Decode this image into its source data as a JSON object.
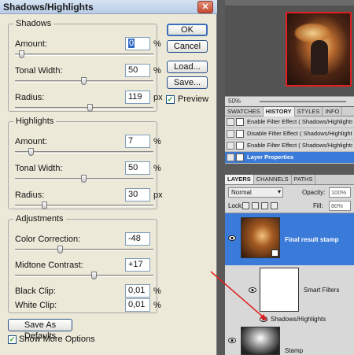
{
  "dialog": {
    "title": "Shadows/Highlights",
    "close_symbol": "✕",
    "buttons": {
      "ok": "OK",
      "cancel": "Cancel",
      "load": "Load...",
      "save": "Save..."
    },
    "preview_label": "Preview",
    "preview_checked": true,
    "shadows": {
      "legend": "Shadows",
      "amount_label": "Amount:",
      "amount_value": "0",
      "amount_unit": "%",
      "amount_pct": 0.03,
      "tonal_label": "Tonal Width:",
      "tonal_value": "50",
      "tonal_unit": "%",
      "tonal_pct": 0.5,
      "radius_label": "Radius:",
      "radius_value": "119",
      "radius_unit": "px",
      "radius_pct": 0.55
    },
    "highlights": {
      "legend": "Highlights",
      "amount_label": "Amount:",
      "amount_value": "7",
      "amount_unit": "%",
      "amount_pct": 0.1,
      "tonal_label": "Tonal Width:",
      "tonal_value": "50",
      "tonal_unit": "%",
      "tonal_pct": 0.5,
      "radius_label": "Radius:",
      "radius_value": "30",
      "radius_unit": "px",
      "radius_pct": 0.2
    },
    "adjustments": {
      "legend": "Adjustments",
      "color_label": "Color Correction:",
      "color_value": "-48",
      "color_pct": 0.32,
      "midtone_label": "Midtone Contrast:",
      "midtone_value": "+17",
      "midtone_pct": 0.58,
      "black_label": "Black Clip:",
      "black_value": "0,01",
      "black_unit": "%",
      "white_label": "White Clip:",
      "white_value": "0,01",
      "white_unit": "%"
    },
    "save_defaults": "Save As Defaults",
    "show_more_label": "Show More Options",
    "show_more_checked": true
  },
  "navigator": {
    "zoom": "50%"
  },
  "history": {
    "tabs": [
      "SWATCHES",
      "HISTORY",
      "STYLES",
      "INFO"
    ],
    "active_tab": "HISTORY",
    "items": [
      "Enable Filter Effect ( Shadows/Highlights )",
      "Disable Filter Effect ( Shadows/Highlights )",
      "Enable Filter Effect ( Shadows/Highlights )",
      "Layer Properties"
    ],
    "selected_index": 3
  },
  "layers_panel": {
    "tabs": [
      "LAYERS",
      "CHANNELS",
      "PATHS"
    ],
    "active_tab": "LAYERS",
    "blend_mode": "Normal",
    "opacity_label": "Opacity:",
    "opacity_value": "100%",
    "lock_label": "Lock:",
    "fill_label": "Fill:",
    "fill_value": "80%",
    "layers": [
      {
        "name": "Final result stamp",
        "selected": true
      },
      {
        "name": "Smart Filters",
        "selected": false
      },
      {
        "name": "Shadows/Highlights",
        "selected": false
      },
      {
        "name": "Stamp",
        "selected": false
      }
    ]
  },
  "colors": {
    "selection": "#3a7ad9",
    "arrow": "#e02020",
    "dialog_bg": "#ece9d8"
  }
}
